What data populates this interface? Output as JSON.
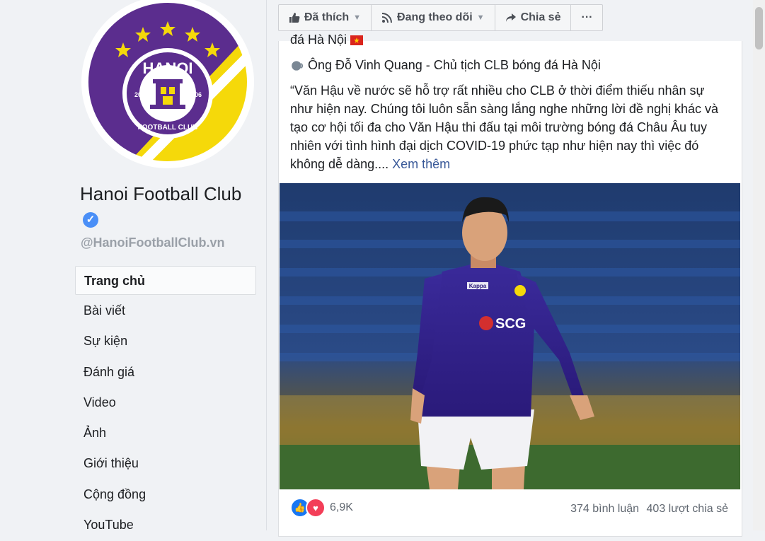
{
  "page": {
    "name": "Hanoi Football Club",
    "handle": "@HanoiFootballClub.vn",
    "logo_text": "HANOI",
    "logo_sub": "FOOTBALL CLUB",
    "logo_year_left": "20",
    "logo_year_right": "06"
  },
  "nav": {
    "items": [
      {
        "label": "Trang chủ",
        "active": true
      },
      {
        "label": "Bài viết"
      },
      {
        "label": "Sự kiện"
      },
      {
        "label": "Đánh giá"
      },
      {
        "label": "Video"
      },
      {
        "label": "Ảnh"
      },
      {
        "label": "Giới thiệu"
      },
      {
        "label": "Cộng đồng"
      },
      {
        "label": "YouTube"
      }
    ]
  },
  "actions": {
    "liked": "Đã thích",
    "following": "Đang theo dõi",
    "share": "Chia sẻ",
    "more": "···"
  },
  "post": {
    "partial_line": "đá Hà Nội",
    "speaker_line": "Ông Đỗ Vinh Quang - Chủ tịch CLB bóng đá Hà Nội",
    "quote": "“Văn Hậu về nước sẽ hỗ trợ rất nhiều cho CLB ở thời điểm thiếu nhân sự như hiện nay. Chúng tôi luôn sẵn sàng lắng nghe những lời đề nghị khác và tạo cơ hội tối đa cho Văn Hậu thi đấu tại môi trường bóng đá Châu Âu tuy nhiên với tình hình đại dịch COVID-19 phức tạp như hiện nay thì việc đó không dễ dàng....",
    "see_more": "Xem thêm",
    "jersey_sponsor": "SCG",
    "jersey_brand": "Kappa",
    "reactions_count": "6,9K",
    "comments": "374 bình luận",
    "shares": "403 lượt chia sẻ"
  },
  "colors": {
    "logo_purple": "#5b2d8e",
    "logo_yellow": "#f5d90a",
    "link": "#385898",
    "like_blue": "#1877f2",
    "heart_red": "#f33e58",
    "verified_blue": "#4a8ff7"
  }
}
